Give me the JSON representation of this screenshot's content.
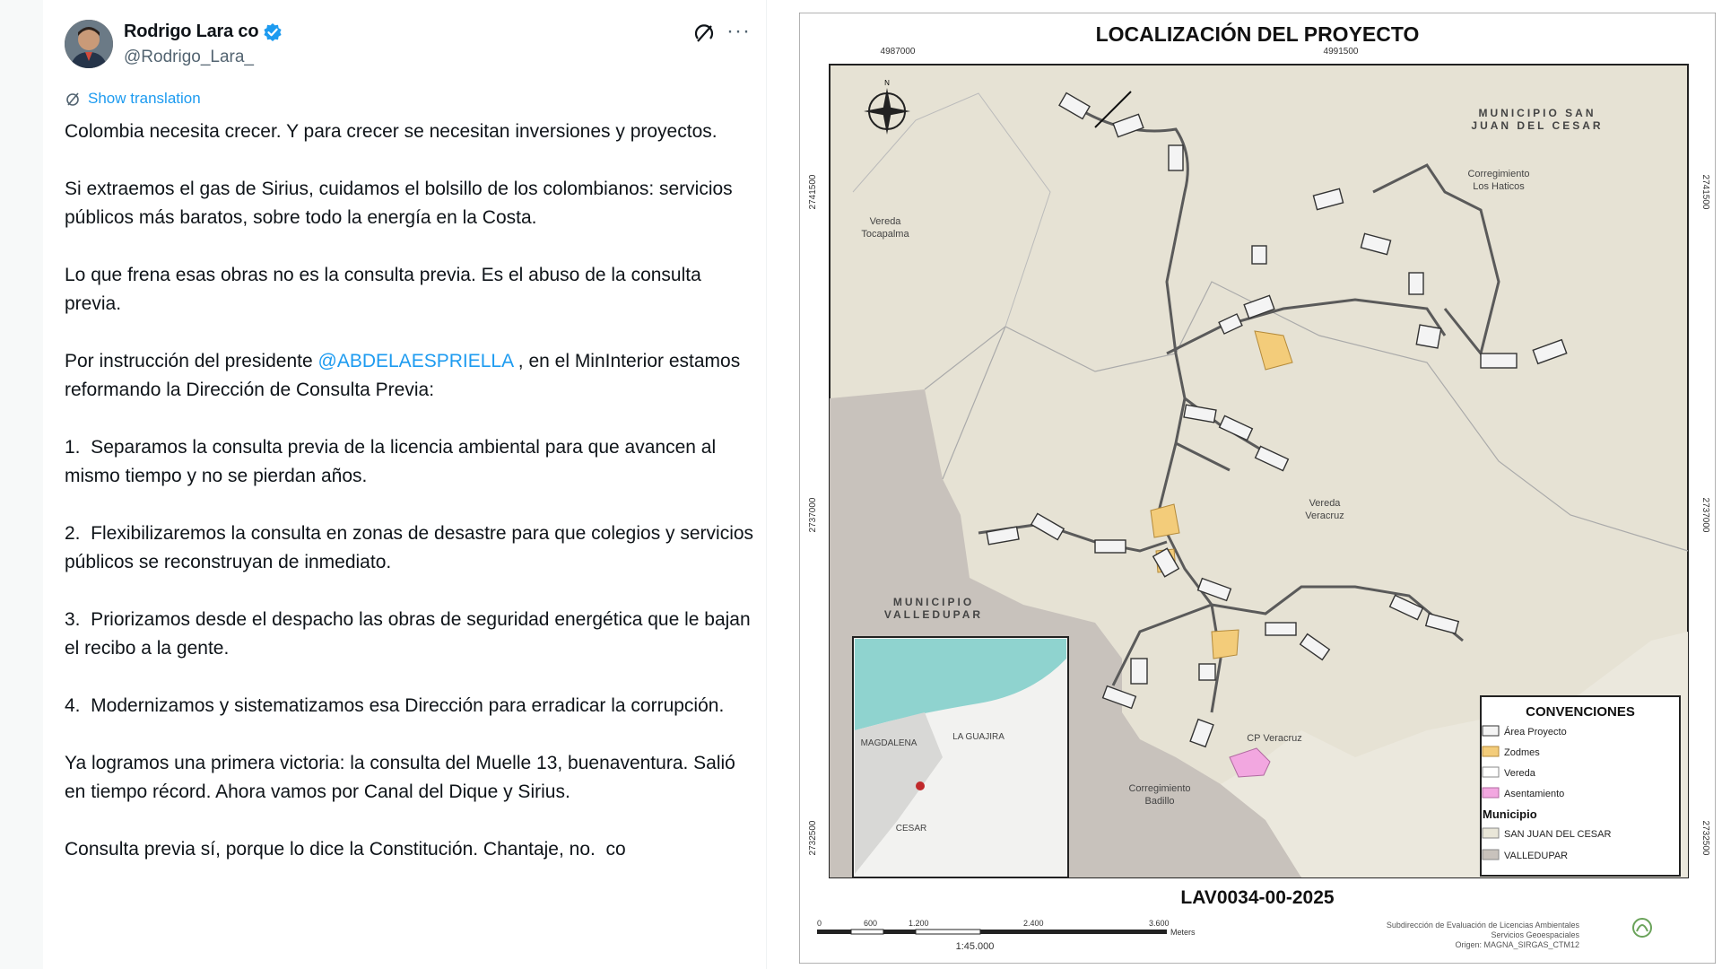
{
  "tweet": {
    "author_name": "Rodrigo Lara co",
    "handle": "@Rodrigo_Lara_",
    "translate_label": "Show translation",
    "paragraphs": [
      "Colombia necesita crecer. Y para crecer se necesitan inversiones y proyectos.",
      "Si extraemos el gas de Sirius, cuidamos el bolsillo de los colombianos: servicios públicos más baratos, sobre todo la energía en la Costa.",
      "Lo que frena esas obras no es la consulta previa. Es el abuso de la consulta previa.",
      "4.  Modernizamos y sistematizamos esa Dirección para erradicar la corrupción.",
      "Ya logramos una primera victoria: la consulta del Muelle 13, buenaventura. Salió en tiempo récord. Ahora vamos por Canal del Dique y Sirius.",
      "Consulta previa sí, porque lo dice la Constitución. Chantaje, no.  co"
    ],
    "mention_prefix": "Por instrucción del presidente ",
    "mention": "@ABDELAESPRIELLA",
    "mention_suffix": " , en el MinInterior estamos reformando la Dirección de Consulta Previa:",
    "list": [
      "1.  Separamos la consulta previa de la licencia ambiental para que avancen al mismo tiempo y no se pierdan años.",
      "2.  Flexibilizaremos la consulta en zonas de desastre para que colegios y servicios públicos se reconstruyan de inmediato.",
      "3.  Priorizamos desde el despacho las obras de seguridad energética que le bajan el recibo a la gente."
    ]
  },
  "map": {
    "title": "LOCALIZACIÓN DEL PROYECTO",
    "coord_top_left": "4987000",
    "coord_top_right": "4991500",
    "coord_left_top": "2741500",
    "coord_left_mid": "2737000",
    "coord_left_bot": "2732500",
    "coord_right_top": "2741500",
    "coord_right_mid": "2737000",
    "coord_right_bot": "2732500",
    "label_municipio_sj_1": "MUNICIPIO SAN",
    "label_municipio_sj_2": "JUAN DEL CESAR",
    "label_corr_haticos_1": "Corregimiento",
    "label_corr_haticos_2": "Los Haticos",
    "label_vereda_toca_1": "Vereda",
    "label_vereda_toca_2": "Tocapalma",
    "label_vereda_vera_1": "Vereda",
    "label_vereda_vera_2": "Veracruz",
    "label_mun_valle_1": "MUNICIPIO",
    "label_mun_valle_2": "VALLEDUPAR",
    "label_cp_veracruz": "CP Veracruz",
    "label_corr_badillo_1": "Corregimiento",
    "label_corr_badillo_2": "Badillo",
    "inset_labels": [
      "MAGDALENA",
      "LA GUAJIRA",
      "CESAR"
    ],
    "legend_title": "CONVENCIONES",
    "legend_items": [
      "Área Proyecto",
      "Zodmes",
      "Vereda",
      "Asentamiento"
    ],
    "legend_municipio": "Municipio",
    "legend_municipios": [
      "SAN JUAN DEL CESAR",
      "VALLEDUPAR"
    ],
    "code": "LAV0034-00-2025",
    "scale_ticks": [
      "0",
      "600",
      "1.200",
      "2.400",
      "3.600"
    ],
    "scale_unit": "Meters",
    "scale_ratio": "1:45.000",
    "credits": [
      "Subdirección de Evaluación de Licencias Ambientales",
      "Servicios Geoespaciales",
      "Origen: MAGNA_SIRGAS_CTM12"
    ],
    "colors": {
      "san_juan": "#e9e6d8",
      "valledupar": "#c8c2bc",
      "zodmes": "#f3cc7a",
      "asentamiento": "#f2a7e0",
      "road": "#5a5a5a"
    }
  }
}
